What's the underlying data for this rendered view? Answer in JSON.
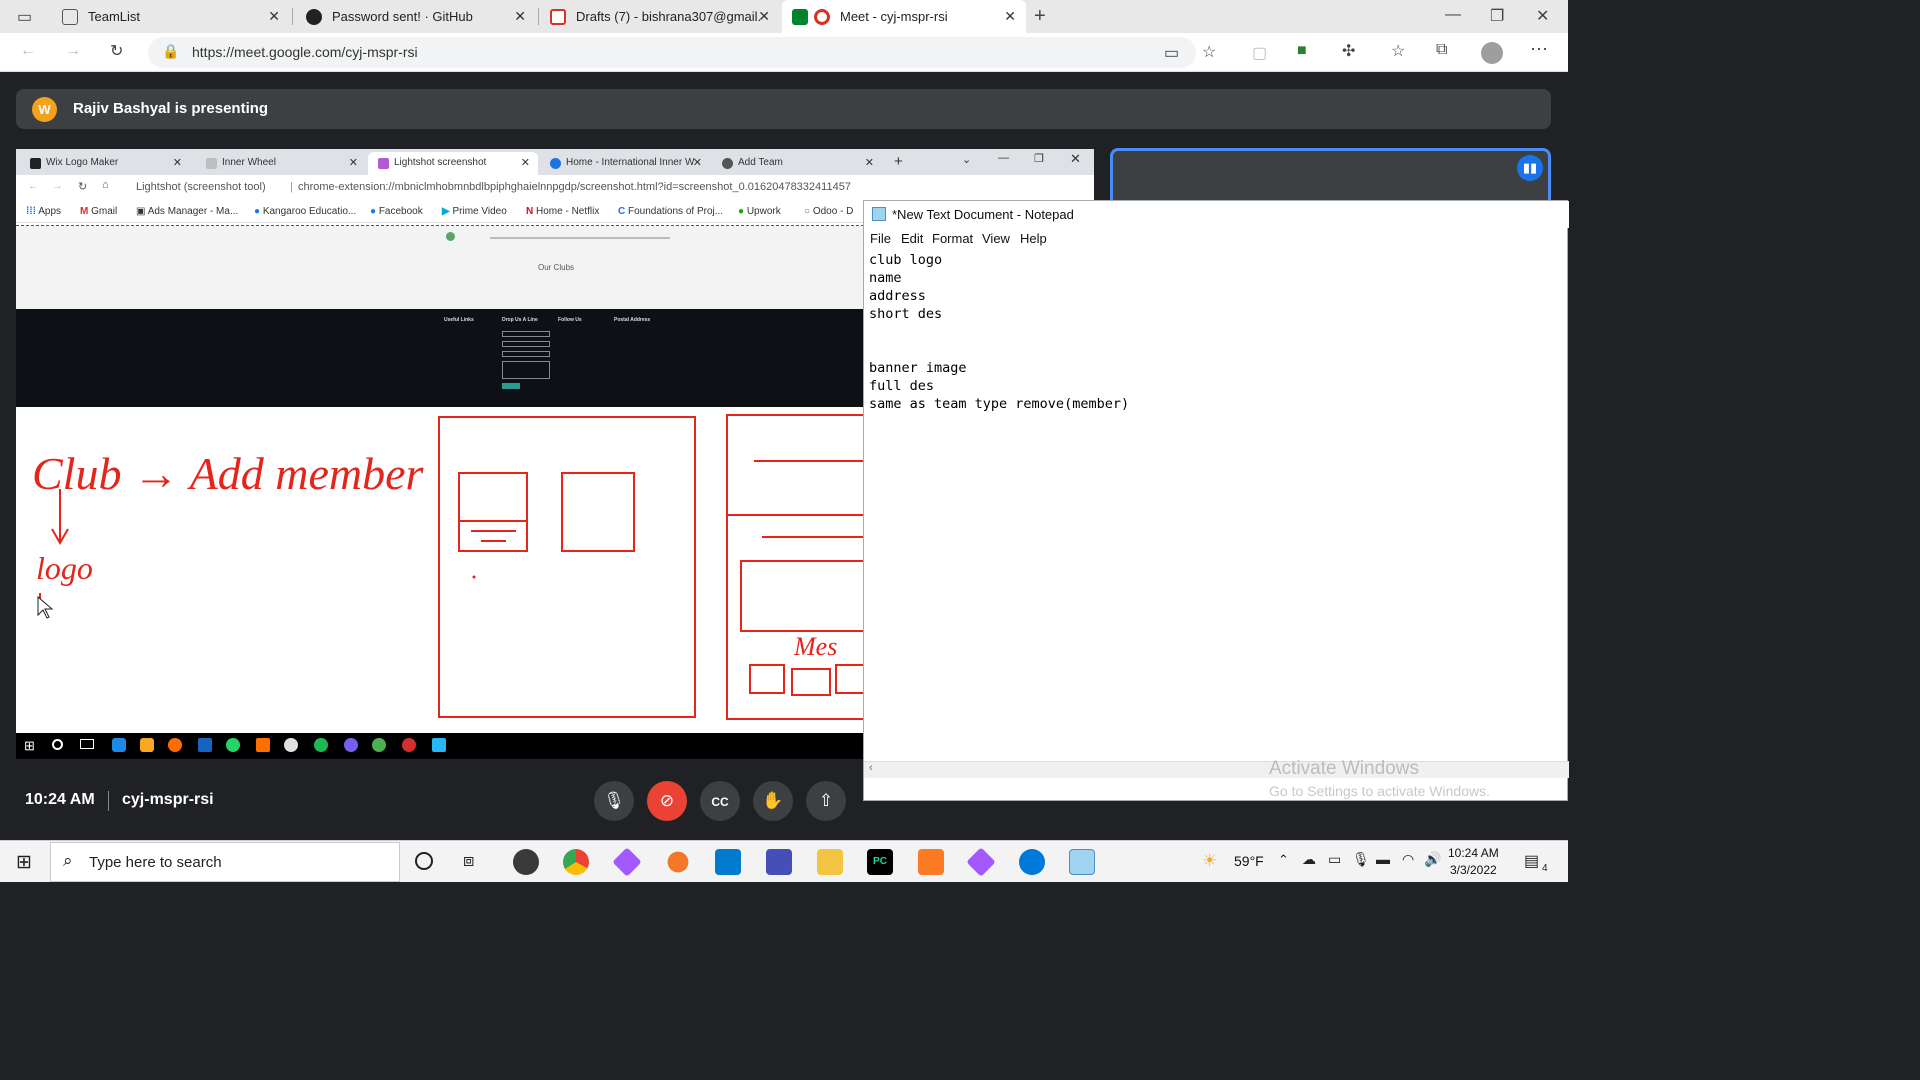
{
  "edge_tabs": [
    {
      "title": "TeamList",
      "icon": "page-icon"
    },
    {
      "title": "Password sent! · GitHub",
      "icon": "github-icon"
    },
    {
      "title": "Drafts (7) - bishrana307@gmail.c",
      "icon": "gmail-icon"
    },
    {
      "title": "Meet - cyj-mspr-rsi",
      "icon": "meet-icon"
    }
  ],
  "edge_url": "https://meet.google.com/cyj-mspr-rsi",
  "presenter_text": "Rajiv Bashyal is presenting",
  "shared_screen": {
    "tabs": [
      "Wix Logo Maker",
      "Inner Wheel",
      "Lightshot screenshot",
      "Home - International Inner W",
      "Add Team"
    ],
    "address_prefix": "Lightshot (screenshot tool)",
    "address": "chrome-extension://mbniclmhobmnbdlbpiphghaielnnpgdp/screenshot.html?id=screenshot_0.01620478332411457",
    "bookmarks": [
      "Apps",
      "Gmail",
      "Ads Manager - Ma...",
      "Kangaroo Educatio...",
      "Facebook",
      "Prime Video",
      "Home - Netflix",
      "Foundations of Proj...",
      "Upwork",
      "Odoo - D"
    ],
    "page_heading": "Our Clubs",
    "footer_cols": [
      "Useful Links",
      "Drop Us A Line",
      "Follow Us",
      "Postal Address"
    ],
    "whiteboard_text": "Club → Add member",
    "whiteboard_sub": "logo",
    "whiteboard_note": "Mes"
  },
  "notepad": {
    "title": "*New Text Document - Notepad",
    "menu": [
      "File",
      "Edit",
      "Format",
      "View",
      "Help"
    ],
    "lines": [
      "club logo",
      "name",
      "address",
      "short des",
      "",
      "",
      "banner image",
      "full des",
      "same as team type remove(member)"
    ],
    "watermark_title": "Activate Windows",
    "watermark_sub": "Go to Settings to activate Windows."
  },
  "meet_bottom": {
    "time": "10:24 AM",
    "code": "cyj-mspr-rsi"
  },
  "taskbar": {
    "search_placeholder": "Type here to search",
    "weather": "59°F",
    "time": "10:24 AM",
    "date": "3/3/2022",
    "notification_count": "4"
  },
  "colors": {
    "meet_bg": "#202124",
    "end_call": "#ea4335",
    "self_border": "#4a8cf7",
    "whiteboard_ink": "#e4251c"
  }
}
